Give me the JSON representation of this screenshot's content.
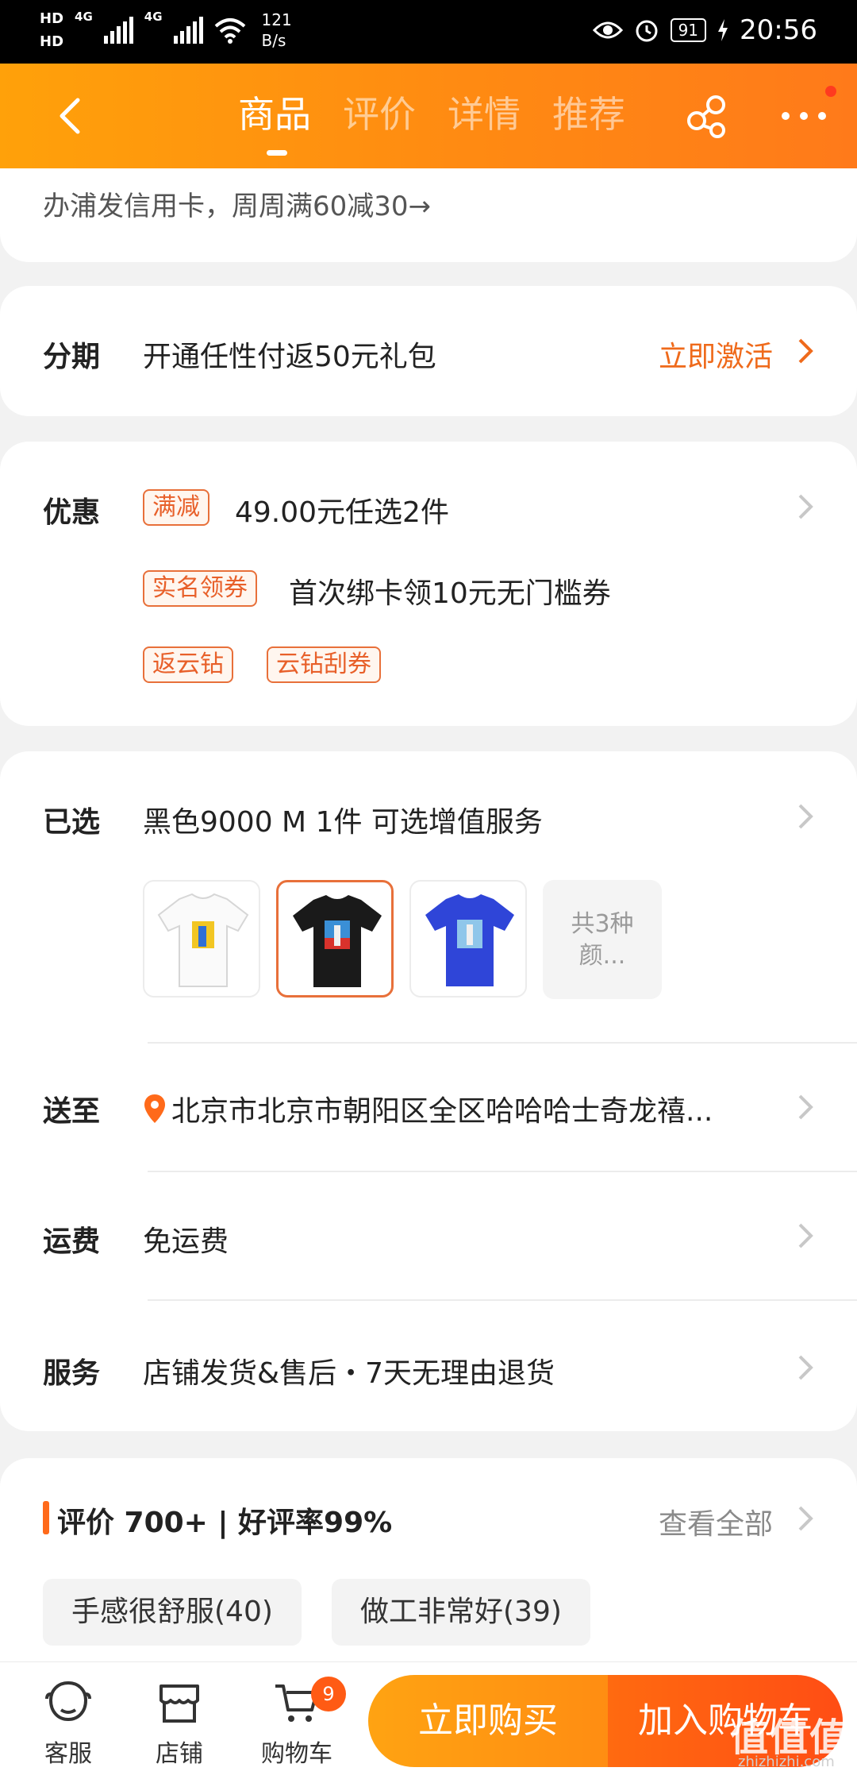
{
  "status_bar": {
    "hd1": "HD",
    "hd2": "HD",
    "sig1_label": "4G",
    "sig2_label": "4G",
    "speed_value": "121",
    "speed_unit": "B/s",
    "battery": "91",
    "time": "20:56"
  },
  "nav": {
    "tabs": [
      "商品",
      "评价",
      "详情",
      "推荐"
    ]
  },
  "promo": {
    "text": "办浦发信用卡，周周满60减30→"
  },
  "installment": {
    "title": "分期",
    "text": "开通任性付返50元礼包",
    "action": "立即激活"
  },
  "discount": {
    "title": "优惠",
    "tag1": "满减",
    "text1": "49.00元任选2件",
    "tag2": "实名领券",
    "text2": "首次绑卡领10元无门槛券",
    "tag3": "返云钻",
    "tag4": "云钻刮券"
  },
  "selected": {
    "title": "已选",
    "text": "黑色9000  M  1件  可选增值服务",
    "more_colors": [
      "共3种",
      "颜..."
    ]
  },
  "delivery": {
    "title": "送至",
    "address": "北京市北京市朝阳区全区哈哈哈士奇龙禧..."
  },
  "shipping": {
    "title": "运费",
    "text": "免运费"
  },
  "service": {
    "title": "服务",
    "text": "店铺发货&售后・7天无理由退货"
  },
  "reviews": {
    "title": "评价 700+ | 好评率99%",
    "see_all": "查看全部",
    "chips": [
      "手感很舒服(40)",
      "做工非常好(39)"
    ]
  },
  "bottom": {
    "customer_service": "客服",
    "store": "店铺",
    "cart": "购物车",
    "cart_badge": "9",
    "buy_now": "立即购买",
    "add_to_cart": "加入购物车"
  },
  "watermark": {
    "main": "值值值",
    "sub": "zhizhizhi.com"
  },
  "colors": {
    "accent": "#ff8a12",
    "tag_border": "#e8703a",
    "buy_now": "#ffa312",
    "add_cart": "#ff4d14"
  }
}
